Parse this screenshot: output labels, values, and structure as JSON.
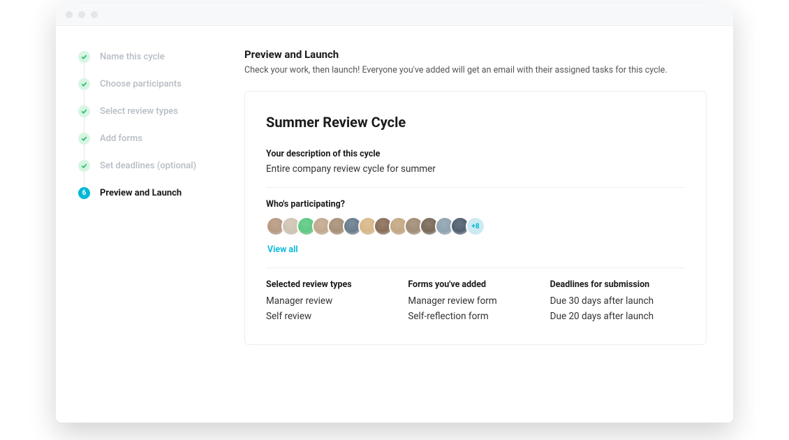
{
  "steps": [
    {
      "label": "Name this cycle"
    },
    {
      "label": "Choose participants"
    },
    {
      "label": "Select review types"
    },
    {
      "label": "Add forms"
    },
    {
      "label": "Set deadlines (optional)"
    },
    {
      "label": "Preview and Launch",
      "number": "6"
    }
  ],
  "header": {
    "title": "Preview and Launch",
    "subtitle": "Check your work, then launch! Everyone you've added will get an email with their assigned tasks for this cycle."
  },
  "card": {
    "title": "Summer Review Cycle",
    "descLabel": "Your description of this cycle",
    "descText": "Entire company review cycle for summer",
    "participantsLabel": "Who's participating?",
    "participantsMore": "+8",
    "viewAll": "View all",
    "col1": {
      "label": "Selected review types",
      "items": [
        "Manager review",
        "Self review"
      ]
    },
    "col2": {
      "label": "Forms you've added",
      "items": [
        "Manager review form",
        "Self-reflection form"
      ]
    },
    "col3": {
      "label": "Deadlines for submission",
      "items": [
        "Due 30 days after launch",
        "Due 20 days after launch"
      ]
    }
  },
  "avatars": [
    "#b89a82",
    "#d0c4b4",
    "#5fc983",
    "#c2a98f",
    "#a89078",
    "#6a7d8c",
    "#d9b88a",
    "#8a6f5a",
    "#c4a884",
    "#a18d76",
    "#7a6a5a",
    "#8fa3b0",
    "#516070"
  ]
}
